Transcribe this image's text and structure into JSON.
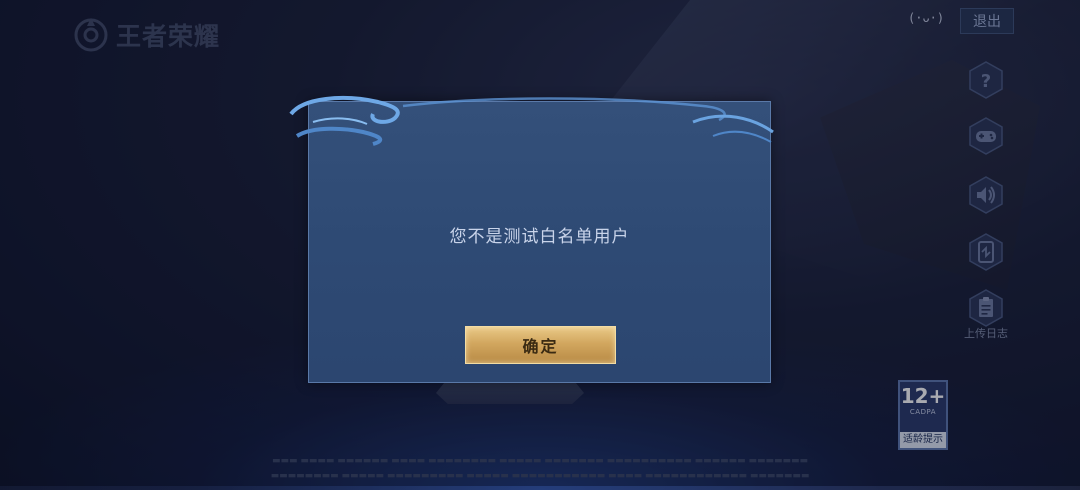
{
  "logo": {
    "text": "王者荣耀"
  },
  "top_right": {
    "signal_icon": "(·ᴗ·)",
    "exit_label": "退出"
  },
  "sidebar": {
    "items": [
      {
        "icon": "help-icon"
      },
      {
        "icon": "gamepad-icon"
      },
      {
        "icon": "speaker-icon"
      },
      {
        "icon": "phone-icon"
      },
      {
        "icon": "clipboard-icon",
        "label": "上传日志"
      }
    ]
  },
  "age_rating": {
    "number": "12+",
    "org": "CADPA",
    "tip": "适龄提示"
  },
  "dialog": {
    "message": "您不是测试白名单用户",
    "confirm_label": "确定"
  },
  "colors": {
    "button_gold": "#d2a75f",
    "dialog_bg": "#2e4a74",
    "dialog_border": "#5a79a8"
  }
}
